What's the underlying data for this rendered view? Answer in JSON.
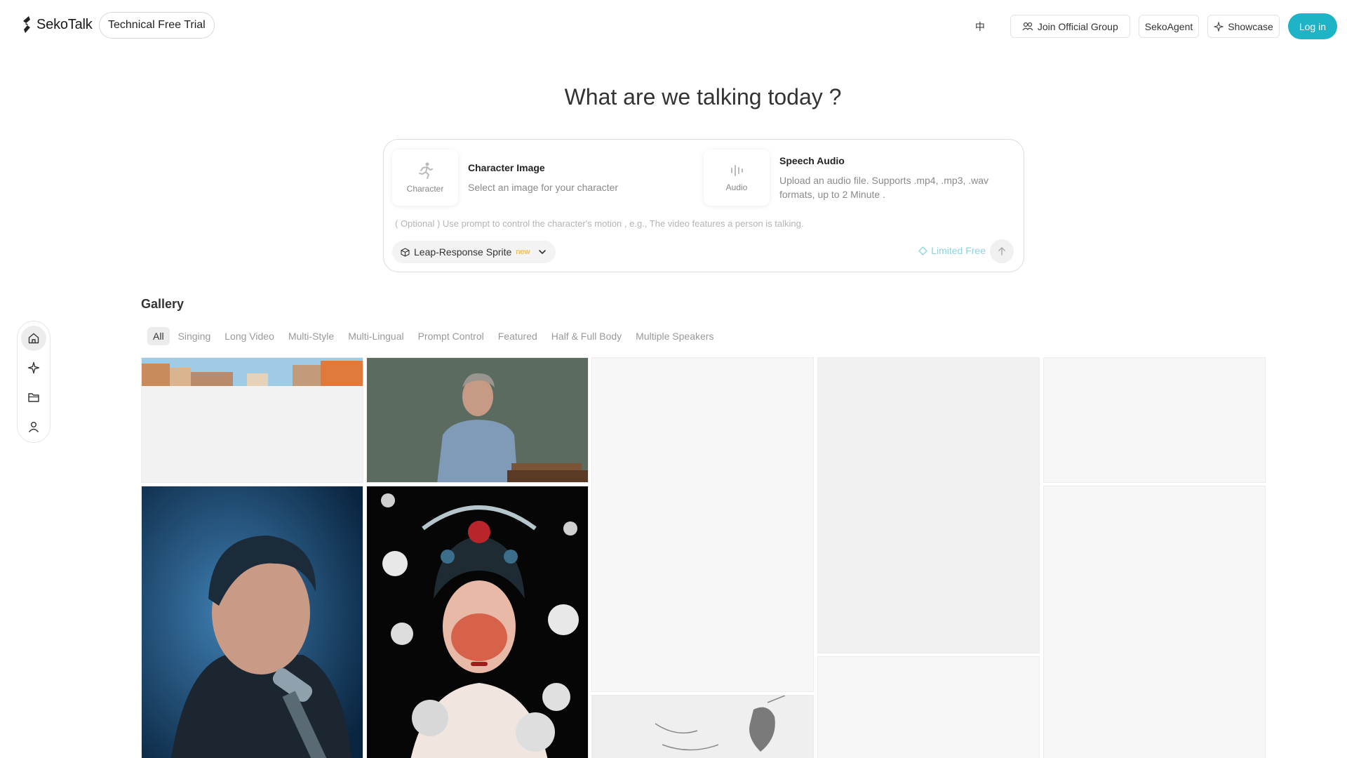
{
  "brand": {
    "name": "SekoTalk"
  },
  "header": {
    "trial_label": "Technical Free Trial",
    "lang_toggle": "中",
    "join_group_label": "Join Official Group",
    "agent_label": "SekoAgent",
    "showcase_label": "Showcase",
    "login_label": "Log in"
  },
  "hero": {
    "title": "What are we talking today ?"
  },
  "composer": {
    "character": {
      "tile_label": "Character",
      "title": "Character Image",
      "description": "Select an image for your character"
    },
    "audio": {
      "tile_label": "Audio",
      "title": "Speech Audio",
      "description": "Upload an audio file. Supports .mp4, .mp3, .wav formats, up to 2 Minute ."
    },
    "prompt_placeholder": "( Optional ) Use prompt to control the character's motion , e.g., The video features a person is talking.",
    "model": {
      "name": "Leap-Response Sprite",
      "badge": "new"
    },
    "limited_free_label": "Limited Free"
  },
  "gallery": {
    "title": "Gallery",
    "filters": [
      "All",
      "Singing",
      "Long Video",
      "Multi-Style",
      "Multi-Lingual",
      "Prompt Control",
      "Featured",
      "Half & Full Body",
      "Multiple Speakers"
    ],
    "active_filter": "All"
  },
  "colors": {
    "accent": "#1fb3c7",
    "limited_free": "#8fd3dc",
    "new_badge": "#e2b33a"
  },
  "icons": {
    "side_rail": [
      "home-icon",
      "sparkle-icon",
      "folder-icon",
      "user-icon"
    ]
  }
}
